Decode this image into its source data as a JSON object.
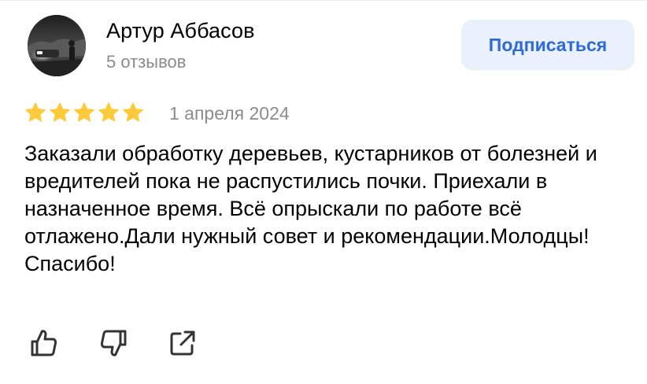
{
  "review": {
    "author": {
      "name": "Артур Аббасов",
      "reviews_count": "5 отзывов",
      "avatar_icon": "user-photo"
    },
    "subscribe_label": "Подписаться",
    "rating": 5,
    "rating_max": 5,
    "date": "1 апреля 2024",
    "text": "Заказали обработку деревьев, кустарников от болезней и вредителей пока не распустились почки. Приехали в назначенное время. Всё опрыскали по работе всё отлажено.Дали нужный совет и рекомендации.Молодцы! Спасибо!",
    "actions": [
      {
        "name": "like",
        "icon": "thumbs-up-icon"
      },
      {
        "name": "dislike",
        "icon": "thumbs-down-icon"
      },
      {
        "name": "share",
        "icon": "share-icon"
      }
    ]
  },
  "colors": {
    "star": "#fdca3a",
    "accent": "#2d69d8",
    "button_bg": "#eaf1fc",
    "secondary_text": "#8b8b8b",
    "icon": "#333333"
  }
}
